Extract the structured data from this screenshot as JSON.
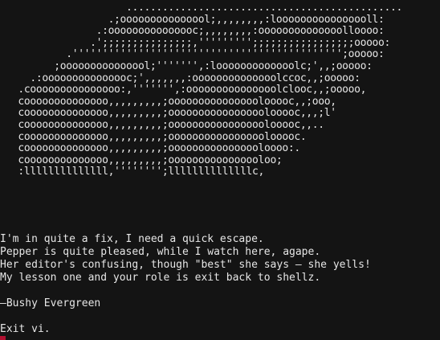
{
  "terminal": {
    "ascii_art": [
      "                     ..............................................",
      "                  .;ooooooooooooool;,,,,,,,,:loooooooooooooooll:",
      "                .:ooooooooooooooc;,,,,,,,,:oooooooooooooolloooo:",
      "               .';;;;;;;;;;;;;;;,''''''''';;;;;;;;;;;;;;;;;ooooo:",
      "           .''''''''''''''''''''''''''''''''''''''''''''';ooooo:",
      "         ;ooooooooooooool;''''''',:looooooooooooolc;',,;ooooo:",
      "     .:ooooooooooooooc;',,,,,,,:oooooooooooooolccoc,,;ooooo:",
      "   .cooooooooooooooo:,''''''',:ooooooooooooooolclooc,,;ooooo,",
      "   coooooooooooooo,,,,,,,,,;ooooooooooooooolooooc,,;ooo,",
      "   coooooooooooooo,,,,,,,,,;oooooooooooooooolooooc,,,;l'",
      "   coooooooooooooo,,,,,,,,,;oooooooooooooooolooooc,,..",
      "   coooooooooooooo,,,,,,,,,;oooooooooooooooolooooc.",
      "   coooooooooooooo,,,,,,,,,;oooooooooooooooloooo:.",
      "   coooooooooooooo,,,,,,,,,;oooooooooooooooloo;",
      "   :llllllllllllll,'''''''';llllllllllllllc,"
    ],
    "poem_lines": [
      "I'm in quite a fix, I need a quick escape.",
      "Pepper is quite pleased, while I watch here, agape.",
      "Her editor's confusing, though \"best\" she says – she yells!",
      "My lesson one and your role is exit back to shellz.",
      "",
      "—Bushy Evergreen",
      "",
      "Exit vi."
    ],
    "colors": {
      "background": "#141414",
      "foreground": "#e6e6e6",
      "cursor": "#b01030"
    }
  }
}
